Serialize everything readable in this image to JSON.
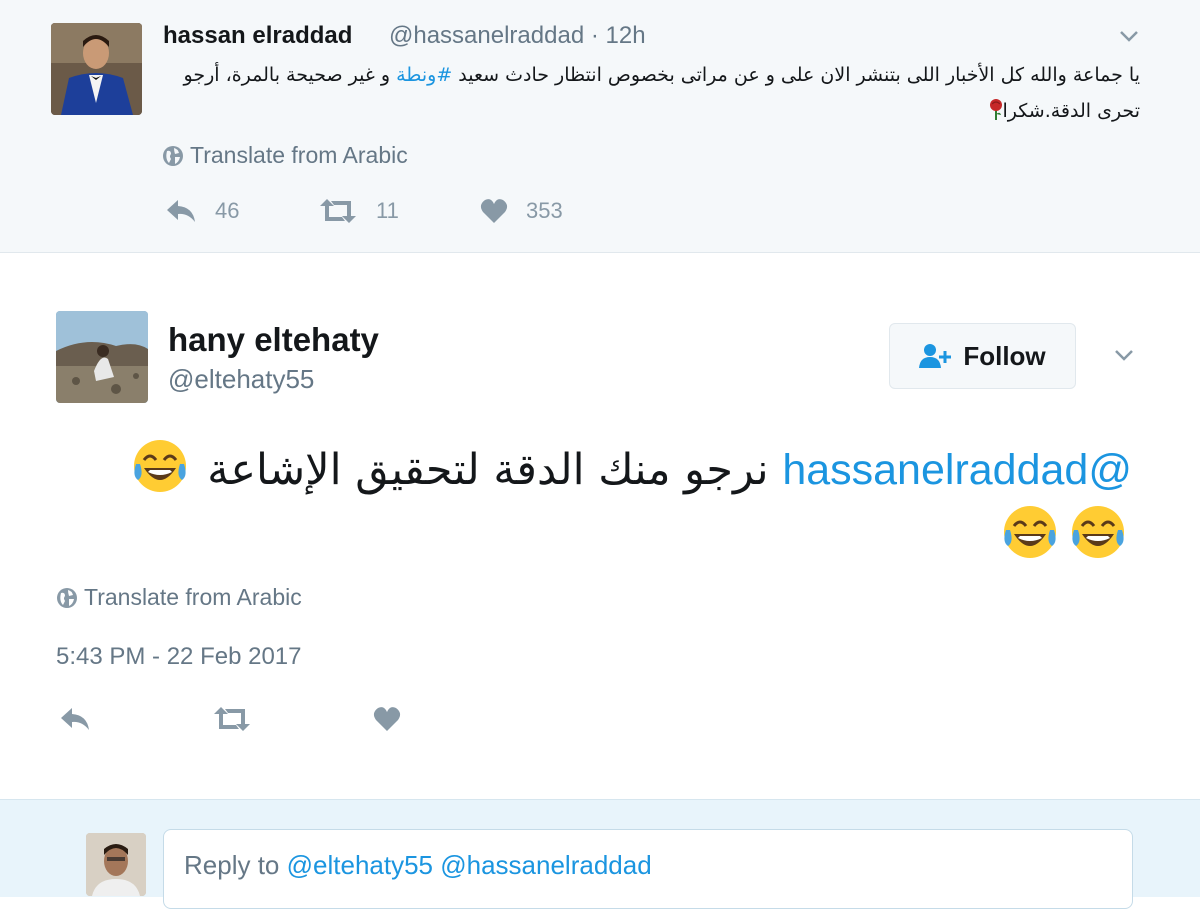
{
  "parent_tweet": {
    "author_name": "hassan elraddad",
    "author_handle": "@hassanelraddad",
    "time_ago": "12h",
    "text_part1": "يا جماعة والله كل الأخبار اللى بتنشر الان على و عن  مراتى بخصوص انتظار حادث سعيد ",
    "hashtag": "#ونطة",
    "text_part2": " و غير صحيحة بالمرة، أرجو تحرى الدقة.شكرا",
    "translate_label": "Translate from Arabic",
    "reply_count": "46",
    "retweet_count": "11",
    "like_count": "353"
  },
  "tweet": {
    "author_name": "hany eltehaty",
    "author_handle": "@eltehaty55",
    "follow_label": "Follow",
    "mention": "@hassanelraddad",
    "text": "نرجو منك الدقة لتحقيق الإشاعة",
    "translate_label": "Translate from Arabic",
    "timestamp": "5:43 PM - 22 Feb 2017"
  },
  "reply": {
    "prefix": "Reply to",
    "mentions": "@eltehaty55 @hassanelraddad"
  },
  "colors": {
    "link": "#1b95e0",
    "muted": "#657786",
    "icon": "#8899a6",
    "parent_bg": "#f5f8fa",
    "reply_bg": "#e8f4fb"
  },
  "icons": [
    "chevron-down-icon",
    "globe-icon",
    "reply-icon",
    "retweet-icon",
    "heart-icon",
    "follow-person-icon",
    "rose-emoji",
    "tears-of-joy-emoji"
  ]
}
